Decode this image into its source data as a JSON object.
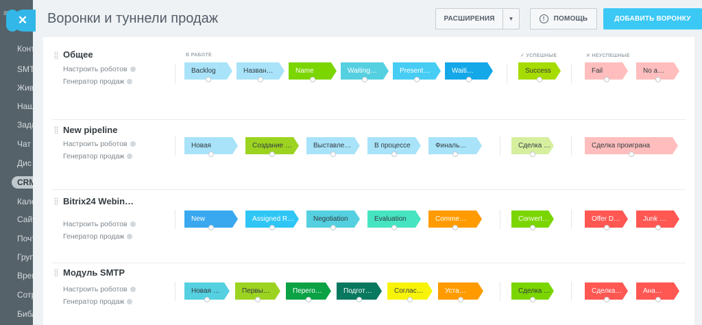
{
  "background_sidebar": {
    "items": [
      "Конт",
      "SMT",
      "Жив",
      "Наш",
      "Зада",
      "Чат",
      "Дис",
      "CRM",
      "Кале",
      "Сайт",
      "Почт",
      "Груп",
      "Врем",
      "Сотр",
      "Библ"
    ],
    "active_index": 7
  },
  "header": {
    "title": "Воронки и туннели продаж",
    "extensions_label": "РАСШИРЕНИЯ",
    "help_label": "ПОМОЩЬ",
    "add_label": "ДОБАВИТЬ ВОРОНКУ"
  },
  "columns": {
    "in_work": "В РАБОТЕ",
    "success": "✓ УСПЕШНЫЕ",
    "failed": "✕ НЕУСПЕШНЫЕ"
  },
  "pipelines": [
    {
      "title": "Общее",
      "robots_label": "Настроить роботов",
      "generator_label": "Генератор продаж",
      "stages": [
        {
          "label": "Backlog",
          "color": "#a8e3f9",
          "text": "light"
        },
        {
          "label": "Назван…",
          "color": "#a8e3f9",
          "text": "light"
        },
        {
          "label": "Name",
          "color": "#7bd500",
          "text": "dark"
        },
        {
          "label": "Waiting…",
          "color": "#55d0e0",
          "text": "dark"
        },
        {
          "label": "Present…",
          "color": "#47cdf4",
          "text": "dark"
        },
        {
          "label": "Waiti…",
          "color": "#14a8e8",
          "text": "dark"
        }
      ],
      "success": [
        {
          "label": "Success",
          "color": "#a6dc00",
          "text": "light"
        }
      ],
      "fail": [
        {
          "label": "Fail",
          "color": "#ffbebd",
          "text": "light"
        },
        {
          "label": "No a…",
          "color": "#ffbebd",
          "text": "light"
        }
      ]
    },
    {
      "title": "New pipeline",
      "robots_label": "Настроить роботов",
      "generator_label": "Генератор продаж",
      "stages": [
        {
          "label": "Новая",
          "color": "#a8e3f9",
          "text": "light"
        },
        {
          "label": "Создание …",
          "color": "#9cd321",
          "text": "light"
        },
        {
          "label": "Выставле…",
          "color": "#a8e3f9",
          "text": "light"
        },
        {
          "label": "В процессе",
          "color": "#a8e3f9",
          "text": "light"
        },
        {
          "label": "Финаль…",
          "color": "#a8e3f9",
          "text": "light"
        }
      ],
      "success": [
        {
          "label": "Сделка …",
          "color": "#d6ef9f",
          "text": "light"
        }
      ],
      "fail": [
        {
          "label": "Сделка проиграна",
          "color": "#ffbebd",
          "text": "light"
        }
      ]
    },
    {
      "title": "Bitrix24 Webin…",
      "robots_label": "Настроить роботов",
      "generator_label": "Генератор продаж",
      "stages": [
        {
          "label": "New",
          "color": "#39a8ef",
          "text": "dark"
        },
        {
          "label": "Assigned R…",
          "color": "#2fc6f6",
          "text": "dark"
        },
        {
          "label": "Negotiation",
          "color": "#55d0e0",
          "text": "light"
        },
        {
          "label": "Evaluation",
          "color": "#47e4c2",
          "text": "light"
        },
        {
          "label": "Comme…",
          "color": "#ff9b00",
          "text": "dark"
        }
      ],
      "success": [
        {
          "label": "Convert…",
          "color": "#7bd500",
          "text": "dark"
        }
      ],
      "fail": [
        {
          "label": "Offer D…",
          "color": "#ff5752",
          "text": "dark"
        },
        {
          "label": "Junk …",
          "color": "#ff5752",
          "text": "dark"
        }
      ]
    },
    {
      "title": "Модуль SMTP",
      "robots_label": "Настроить роботов",
      "generator_label": "Генератор продаж",
      "stages": [
        {
          "label": "Новая …",
          "color": "#55d0e0",
          "text": "light"
        },
        {
          "label": "Первы…",
          "color": "#9cd321",
          "text": "light"
        },
        {
          "label": "Перего…",
          "color": "#0ba245",
          "text": "dark"
        },
        {
          "label": "Подгот…",
          "color": "#08785f",
          "text": "dark"
        },
        {
          "label": "Соглас…",
          "color": "#f7f40a",
          "text": "light"
        },
        {
          "label": "Уста…",
          "color": "#ff9b00",
          "text": "dark"
        }
      ],
      "success": [
        {
          "label": "Сделка …",
          "color": "#7bd500",
          "text": "light"
        }
      ],
      "fail": [
        {
          "label": "Сделка…",
          "color": "#ff5752",
          "text": "dark"
        },
        {
          "label": "Ана…",
          "color": "#ff5752",
          "text": "dark"
        }
      ]
    }
  ]
}
